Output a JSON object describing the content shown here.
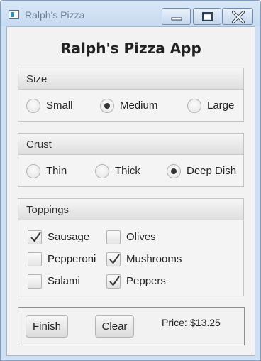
{
  "window": {
    "title": "Ralph's Pizza",
    "icon": "app-window-icon",
    "controls": [
      "minimize-icon",
      "maximize-icon",
      "close-icon"
    ]
  },
  "app": {
    "title": "Ralph's Pizza App"
  },
  "size": {
    "label": "Size",
    "options": [
      "Small",
      "Medium",
      "Large"
    ],
    "selected": "Medium"
  },
  "crust": {
    "label": "Crust",
    "options": [
      "Thin",
      "Thick",
      "Deep Dish"
    ],
    "selected": "Deep Dish"
  },
  "toppings": {
    "label": "Toppings",
    "items": [
      {
        "label": "Sausage",
        "checked": true
      },
      {
        "label": "Pepperoni",
        "checked": false
      },
      {
        "label": "Salami",
        "checked": false
      },
      {
        "label": "Olives",
        "checked": false
      },
      {
        "label": "Mushrooms",
        "checked": true
      },
      {
        "label": "Peppers",
        "checked": true
      }
    ]
  },
  "actions": {
    "finish_label": "Finish",
    "clear_label": "Clear"
  },
  "price": {
    "label": "Price:",
    "value": "$13.25"
  }
}
